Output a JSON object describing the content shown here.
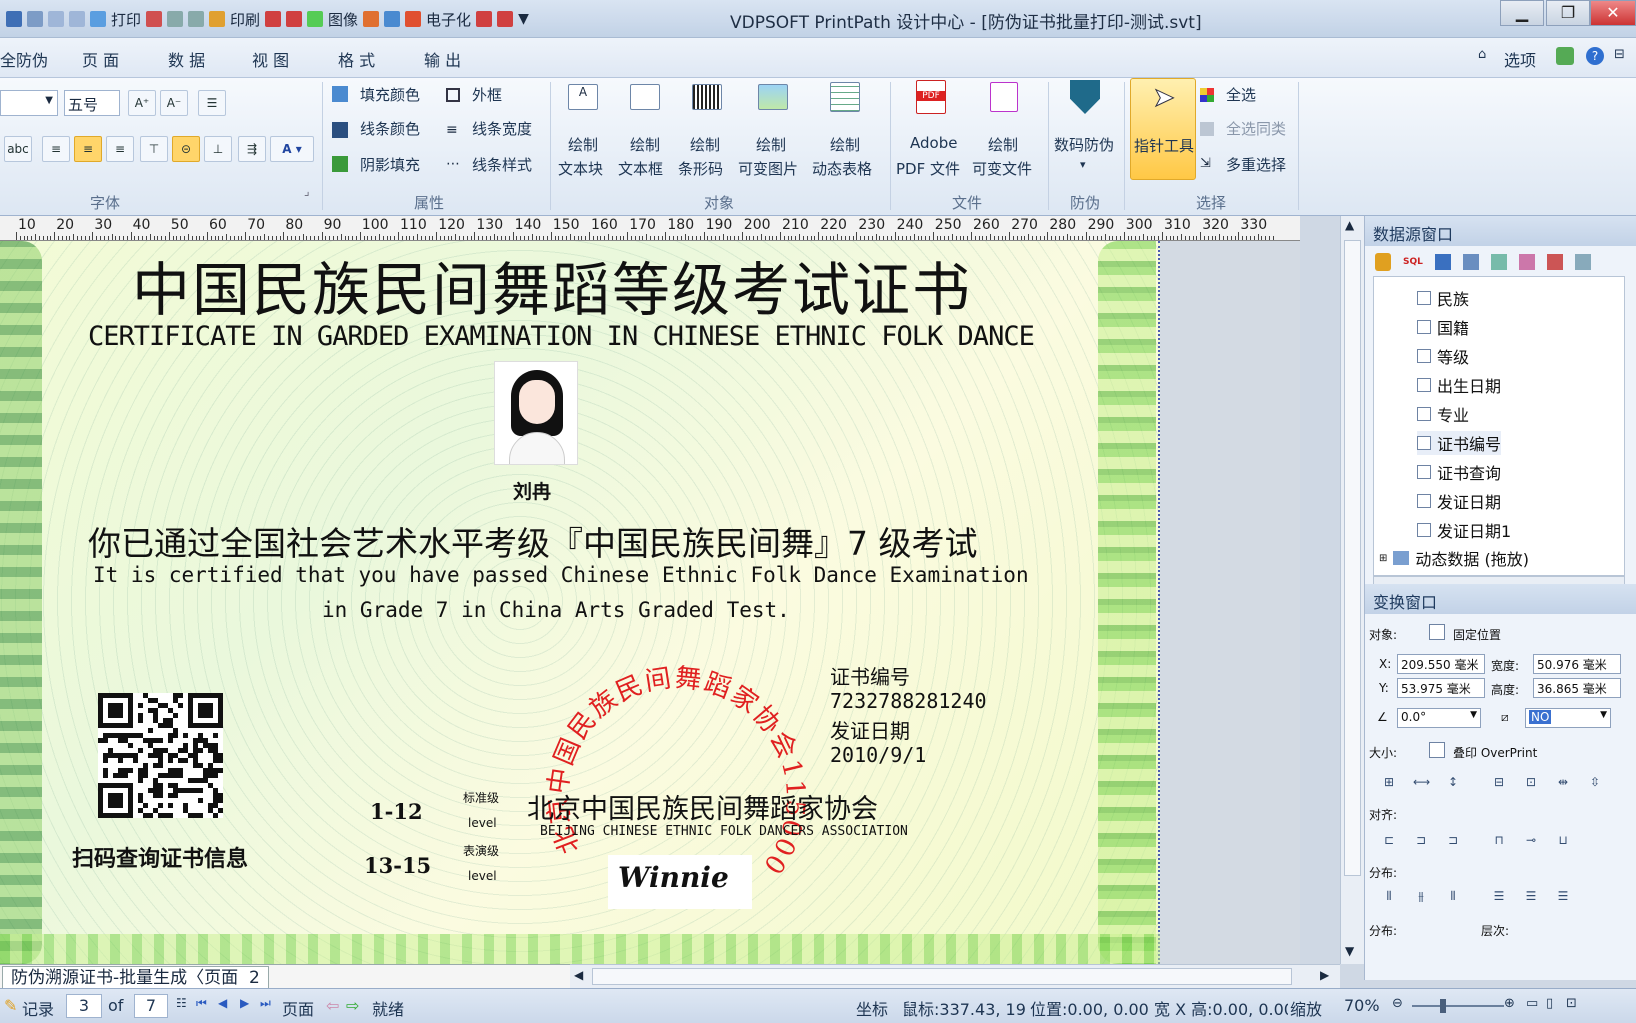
{
  "titlebar": {
    "quick_access": [
      "打印",
      "印刷",
      "图像",
      "电子化"
    ],
    "title": "VDPSOFT PrintPath 设计中心 - [防伪证书批量打印-测试.svt]"
  },
  "menubar": {
    "items": [
      "全防伪",
      "页 面",
      "数 据",
      "视 图",
      "格 式",
      "输 出"
    ],
    "options_label": "选项"
  },
  "ribbon": {
    "font": {
      "size": "五号",
      "group_label": "字体"
    },
    "attributes": {
      "fill_color": "填充颜色",
      "line_color": "线条颜色",
      "shadow_fill": "阴影填充",
      "outer_frame": "外框",
      "line_width": "线条宽度",
      "line_style": "线条样式",
      "group_label": "属性"
    },
    "objects": {
      "draw_textblock": [
        "绘制",
        "文本块"
      ],
      "draw_textbox": [
        "绘制",
        "文本框"
      ],
      "draw_barcode": [
        "绘制",
        "条形码"
      ],
      "draw_varimage": [
        "绘制",
        "可变图片"
      ],
      "draw_dyntable": [
        "绘制",
        "动态表格"
      ],
      "group_label": "对象"
    },
    "file": {
      "adobe_pdf": [
        "Adobe",
        "PDF 文件"
      ],
      "draw_varfile": [
        "绘制",
        "可变文件"
      ],
      "group_label": "文件"
    },
    "security": {
      "digital": "数码防伪",
      "group_label": "防伪"
    },
    "select": {
      "pointer": "指针工具",
      "select_all": "全选",
      "select_same": "全选同类",
      "multi_select": "多重选择",
      "group_label": "选择"
    }
  },
  "ruler": {
    "labels": [
      "10",
      "20",
      "30",
      "40",
      "50",
      "60",
      "70",
      "80",
      "90",
      "100",
      "110",
      "120",
      "130",
      "140",
      "150",
      "160",
      "170",
      "180",
      "190",
      "200",
      "210",
      "220",
      "230",
      "240",
      "250",
      "260",
      "270",
      "280",
      "290",
      "300",
      "310",
      "320",
      "330"
    ]
  },
  "certificate": {
    "title_cn": "中国民族民间舞蹈等级考试证书",
    "title_en": "CERTIFICATE IN GARDED EXAMINATION IN CHINESE ETHNIC FOLK DANCE",
    "name": "刘冉",
    "passed_cn": "你已通过全国社会艺术水平考级『中国民族民间舞』7 级考试",
    "passed_en1": "It is certified that you have passed Chinese Ethnic Folk Dance Examination",
    "passed_en2": "in Grade 7 in China Arts Graded Test.",
    "cert_no_label": "证书编号",
    "cert_no": "7232788281240",
    "issue_date_label": "发证日期",
    "issue_date": "2010/9/1",
    "qr_caption": "扫码查询证书信息",
    "level1_range": "1-12",
    "level1_label": "标准级",
    "level1_en": "level",
    "level2_range": "13-15",
    "level2_label": "表演级",
    "level2_en": "level",
    "assoc_cn": "北京中国民族民间舞蹈家协会",
    "assoc_en": "BEIJING CHINESE ETHNIC FOLK DANCERS ASSOCIATION",
    "seal_text": "北京中国民族民间舞蹈家协会11500000000233210",
    "signature": "Winnie"
  },
  "datasource": {
    "title": "数据源窗口",
    "items": [
      "民族",
      "国籍",
      "等级",
      "出生日期",
      "专业",
      "证书编号",
      "证书查询",
      "发证日期",
      "发证日期1"
    ],
    "dynamic": "动态数据 (拖放)"
  },
  "transform": {
    "title": "变换窗口",
    "object_label": "对象:",
    "fixed_pos": "固定位置",
    "x_label": "X:",
    "x": "209.550 毫米",
    "w_label": "宽度:",
    "w": "50.976 毫米",
    "y_label": "Y:",
    "y": "53.975 毫米",
    "h_label": "高度:",
    "h": "36.865 毫米",
    "rotation": "0.0°",
    "skew": "NO",
    "size_label": "大小:",
    "overprint": "叠印 OverPrint",
    "align_label": "对齐:",
    "distribute_label": "分布:",
    "distribute2_label": "分布:",
    "layer_label": "层次:"
  },
  "tabbar": {
    "tab": "防伪溯源证书-批量生成",
    "page_label": "页面",
    "page": "2"
  },
  "statusbar": {
    "record_label": "记录",
    "record": "3",
    "of_label": "of",
    "total": "7",
    "page_label": "页面",
    "status": "就绪",
    "coord_label": "坐标",
    "mouse": "鼠标:337.43, 19(",
    "position": "位置:0.00, 0.00",
    "size": "宽 X 高:0.00, 0.00",
    "zoom_label": "缩放",
    "zoom": "70%"
  },
  "colors": {
    "accent": "#ffd56a",
    "seal": "#e02020",
    "ribbon_bg": "#dde7f3"
  }
}
